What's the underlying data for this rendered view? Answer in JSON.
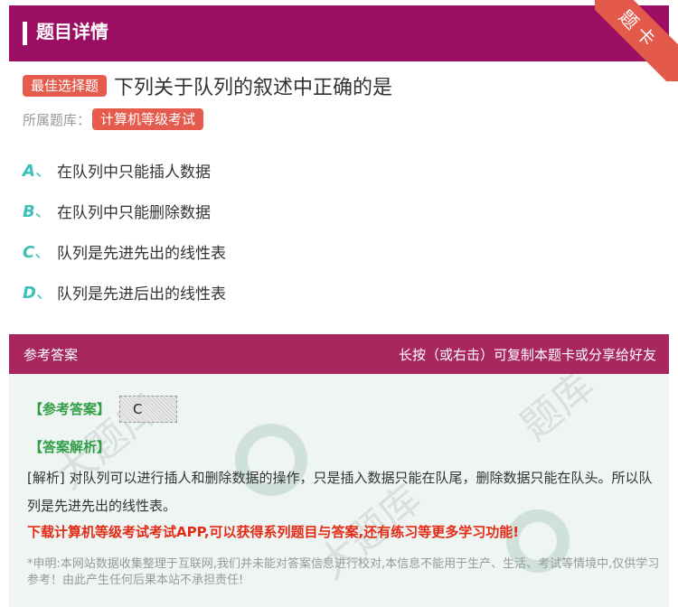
{
  "header": {
    "title": "题目详情",
    "corner_tag": "题卡"
  },
  "question": {
    "type_tag": "最佳选择题",
    "text": "下列关于队列的叙述中正确的是",
    "category_label": "所属题库：",
    "category": "计算机等级考试"
  },
  "options": [
    {
      "letter": "A",
      "sep": "、",
      "text": "在队列中只能插人数据"
    },
    {
      "letter": "B",
      "sep": "、",
      "text": "在队列中只能删除数据"
    },
    {
      "letter": "C",
      "sep": "、",
      "text": "队列是先进先出的线性表"
    },
    {
      "letter": "D",
      "sep": "、",
      "text": "队列是先进后出的线性表"
    }
  ],
  "answer": {
    "header_left": "参考答案",
    "header_right": "长按（或右击）可复制本题卡或分享给好友",
    "answer_label": "【参考答案】",
    "answer_value": "C",
    "analysis_label": "【答案解析】",
    "analysis_text": "[解析] 对队列可以进行插人和删除数据的操作，只是插入数据只能在队尾，删除数据只能在队头。所以队列是先进先出的线性表。",
    "promo": "下载计算机等级考试考试APP,可以获得系列题目与答案,还有练习等更多学习功能!",
    "disclaimer": "*申明:本网站数据收集整理于互联网,我们并未能对答案信息进行校对,本信息不能用于生产、生活、考试等情境中,仅供学习参考！由此产生任何后果本站不承担责任!"
  },
  "colors": {
    "header_bg": "#9c0e63",
    "tag_red": "#e55b4d",
    "option_letter": "#3bbfb6",
    "answer_green": "#2f9e46",
    "promo_red": "#e52b16"
  }
}
